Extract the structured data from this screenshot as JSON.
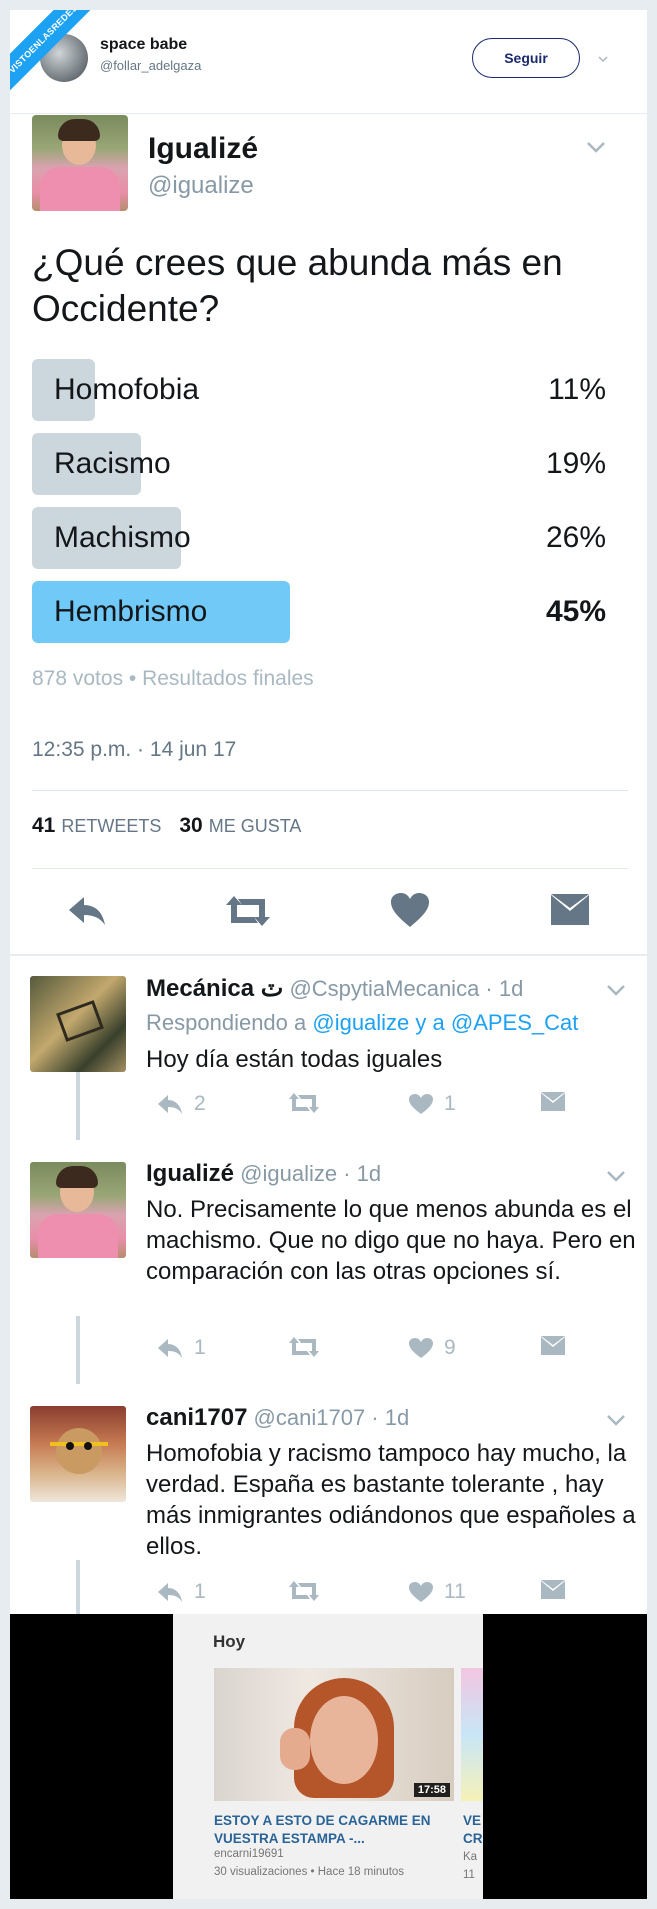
{
  "watermark": "VISTOENLASREDES.com",
  "retweeter": {
    "name": "space babe",
    "handle": "@follar_adelgaza",
    "follow_label": "Seguir"
  },
  "tweet": {
    "name": "Igualizé",
    "handle": "@igualize",
    "question": "¿Qué crees que abunda más en Occidente?",
    "poll": [
      {
        "label": "Homofobia",
        "percent_label": "11%",
        "percent": 11
      },
      {
        "label": "Racismo",
        "percent_label": "19%",
        "percent": 19
      },
      {
        "label": "Machismo",
        "percent_label": "26%",
        "percent": 26
      },
      {
        "label": "Hembrismo",
        "percent_label": "45%",
        "percent": 45,
        "winner": true
      }
    ],
    "poll_meta": "878 votos • Resultados finales",
    "timestamp": "12:35 p.m. · 14 jun 17",
    "retweets_count": "41",
    "retweets_label": "RETWEETS",
    "likes_count": "30",
    "likes_label": "ME GUSTA"
  },
  "replies": [
    {
      "name": "Mecánica ٽ",
      "meta": "@CspytiaMecanica · 1d",
      "context_prefix": "Respondiendo a ",
      "context_links": "@igualize y a @APES_Cat",
      "text": "Hoy día están todas iguales",
      "reply_count": "2",
      "retweet_count": "",
      "like_count": "1"
    },
    {
      "name": "Igualizé",
      "meta": "@igualize · 1d",
      "text": "No. Precisamente lo que menos abunda es el machismo. Que no digo que no haya. Pero en comparación con las otras opciones sí.",
      "reply_count": "1",
      "retweet_count": "",
      "like_count": "9"
    },
    {
      "name": "cani1707",
      "meta": "@cani1707 · 1d",
      "text": "Homofobia y racismo tampoco hay mucho, la verdad. España es bastante tolerante , hay más inmigrantes odiándonos que españoles a ellos.",
      "reply_count": "1",
      "retweet_count": "",
      "like_count": "11"
    }
  ],
  "video_panel": {
    "section": "Hoy",
    "duration": "17:58",
    "title": "ESTOY A ESTO DE CAGARME EN VUESTRA ESTAMPA -...",
    "channel": "encarni19691",
    "views": "30 visualizaciones • Hace 18 minutos",
    "side_title": "VE\nCR",
    "side_sub": "Ka\n11"
  },
  "colors": {
    "accent": "#1da1f2",
    "poll_winner": "#71c9f8",
    "poll_bar": "#ccd6dd",
    "follow_border": "#1b2a6b"
  }
}
